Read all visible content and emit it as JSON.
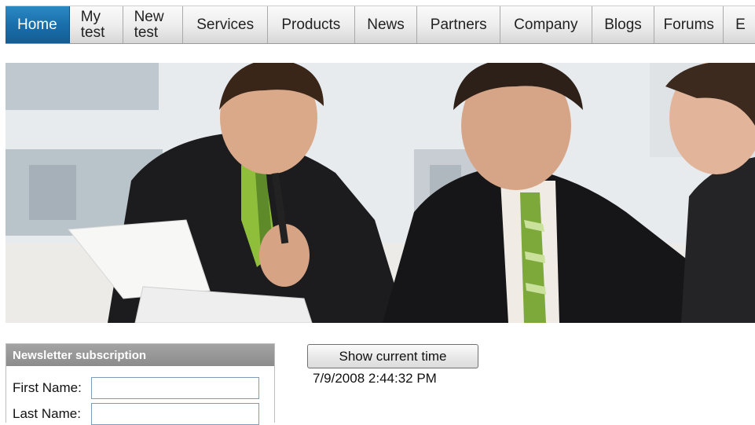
{
  "nav": {
    "items": [
      {
        "line1": "Home",
        "line2": ""
      },
      {
        "line1": "My",
        "line2": "test"
      },
      {
        "line1": "New",
        "line2": "test"
      },
      {
        "line1": "Services",
        "line2": ""
      },
      {
        "line1": "Products",
        "line2": ""
      },
      {
        "line1": "News",
        "line2": ""
      },
      {
        "line1": "Partners",
        "line2": ""
      },
      {
        "line1": "Company",
        "line2": ""
      },
      {
        "line1": "Blogs",
        "line2": ""
      },
      {
        "line1": "Forums",
        "line2": ""
      },
      {
        "line1": "E",
        "line2": ""
      }
    ],
    "active_color": "#1a6fab"
  },
  "newsletter": {
    "title": "Newsletter subscription",
    "first_name_label": "First Name:",
    "first_name_value": "",
    "last_name_label": "Last Name:",
    "last_name_value": ""
  },
  "time_widget": {
    "button_label": "Show current time",
    "value": "7/9/2008 2:44:32 PM"
  }
}
